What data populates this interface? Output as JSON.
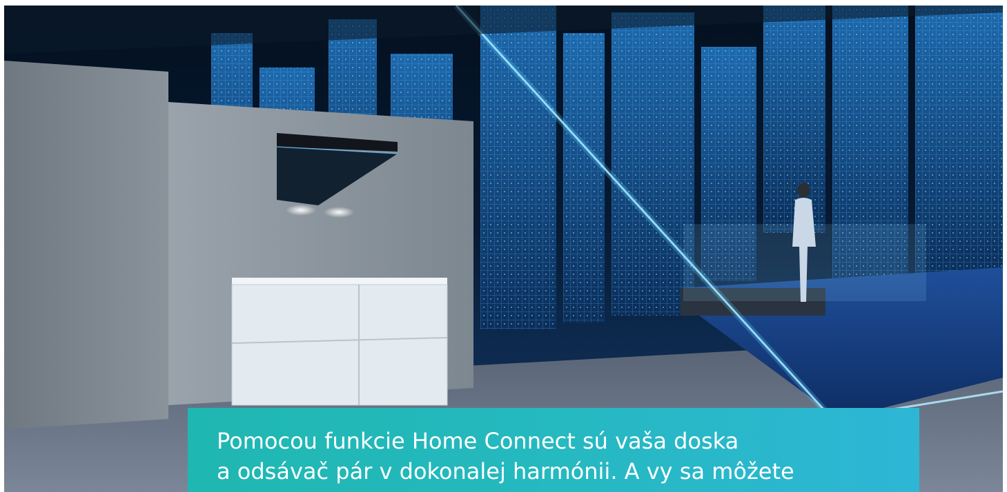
{
  "hero": {
    "scene": "kitchen-hood-city-hologram",
    "colors": {
      "accent": "#2bb8c4",
      "glow": "#49b8ff",
      "wall": "#8d959d",
      "cabinet": "#e6edf3"
    }
  },
  "caption": {
    "line1": "Pomocou funkcie Home Connect sú vaša doska",
    "line2": "a odsávač pár v dokonalej harmónii. A vy sa môžete"
  }
}
